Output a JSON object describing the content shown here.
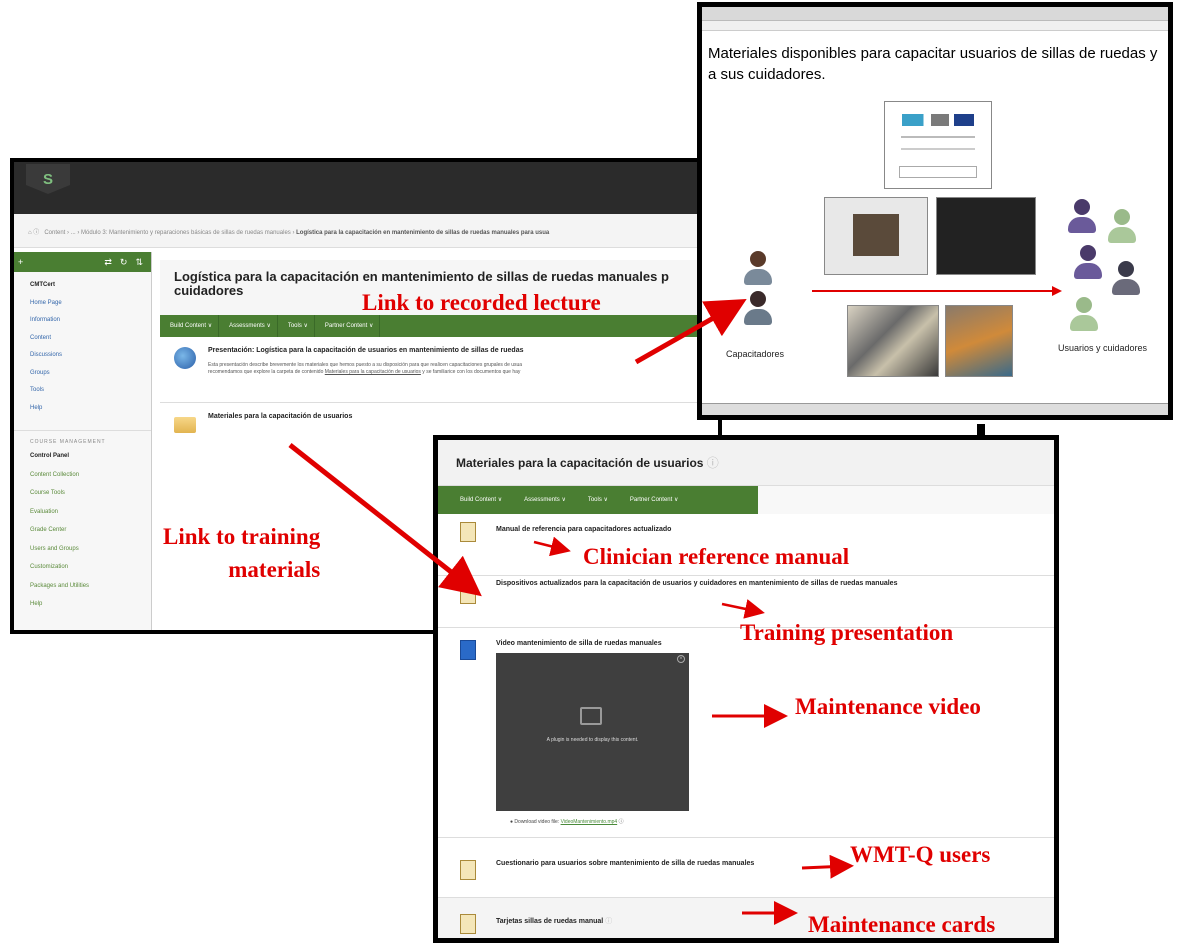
{
  "lms": {
    "breadcrumb": {
      "parts": "Content › ... › Módulo 3: Mantenimiento y reparaciones básicas de sillas de ruedas manuales ›",
      "current": "Logística para la capacitación en mantenimiento de sillas de ruedas manuales para usua"
    },
    "page_title": "Logística para la capacitación en mantenimiento de sillas de ruedas manuales p cuidadores",
    "sidebar": {
      "course_name": "CMTCert",
      "items": [
        "Home Page",
        "Information",
        "Content",
        "Discussions",
        "Groups",
        "Tools",
        "Help"
      ],
      "course_management_label": "COURSE MANAGEMENT",
      "management_items": [
        "Control Panel",
        "Content Collection",
        "Course Tools",
        "Evaluation",
        "Grade Center",
        "Users and Groups",
        "Customization",
        "Packages and Utilities",
        "Help"
      ]
    },
    "action_bar": [
      "Build Content ∨",
      "Assessments ∨",
      "Tools ∨",
      "Partner Content ∨"
    ],
    "items": [
      {
        "title": "Presentación: Logística para la capacitación de usuarios en mantenimiento de sillas de ruedas",
        "desc_line1": "Esta presentación describe brevemente los materiales que hemos puesto a su disposición para que realicen capacitaciones grupales de usua",
        "desc_line2_pre": "recomendamos que explore la carpeta de contenido ",
        "desc_link": "Materiales para la capacitación de usuarios",
        "desc_line2_post": " y se familiarice con los documentos que hay"
      },
      {
        "title": "Materiales para la capacitación de usuarios"
      }
    ]
  },
  "slide": {
    "title": "Materiales disponibles para capacitar usuarios de sillas de ruedas y a sus cuidadores.",
    "label_left": "Capacitadores",
    "label_right": "Usuarios y cuidadores"
  },
  "materials": {
    "title": "Materiales para la capacitación de usuarios",
    "action_bar": [
      "Build Content ∨",
      "Assessments ∨",
      "Tools ∨",
      "Partner Content ∨"
    ],
    "rows": [
      "Manual de referencia para capacitadores actualizado",
      "Dispositivos actualizados para la capacitación de usuarios y cuidadores en mantenimiento de sillas de ruedas manuales",
      "Video mantenimiento de silla de ruedas manuales",
      "Cuestionario para usuarios sobre mantenimiento de silla de ruedas manuales",
      "Tarjetas sillas de ruedas manual"
    ],
    "plugin_text": "A plugin is needed to display this content.",
    "download_pre": "Download video file: ",
    "download_link": "VideoMantenimiento.mp4"
  },
  "annotations": {
    "recorded_lecture": "Link to recorded lecture",
    "training_materials_1": "Link to training",
    "training_materials_2": "materials",
    "clinician_manual": "Clinician reference manual",
    "training_presentation": "Training presentation",
    "maintenance_video": "Maintenance video",
    "wmtq_users": "WMT-Q users",
    "maintenance_cards": "Maintenance cards"
  },
  "colors": {
    "lms_green": "#4a7e32",
    "annotation_red": "#e00000",
    "dark_header": "#2b2b2b"
  }
}
